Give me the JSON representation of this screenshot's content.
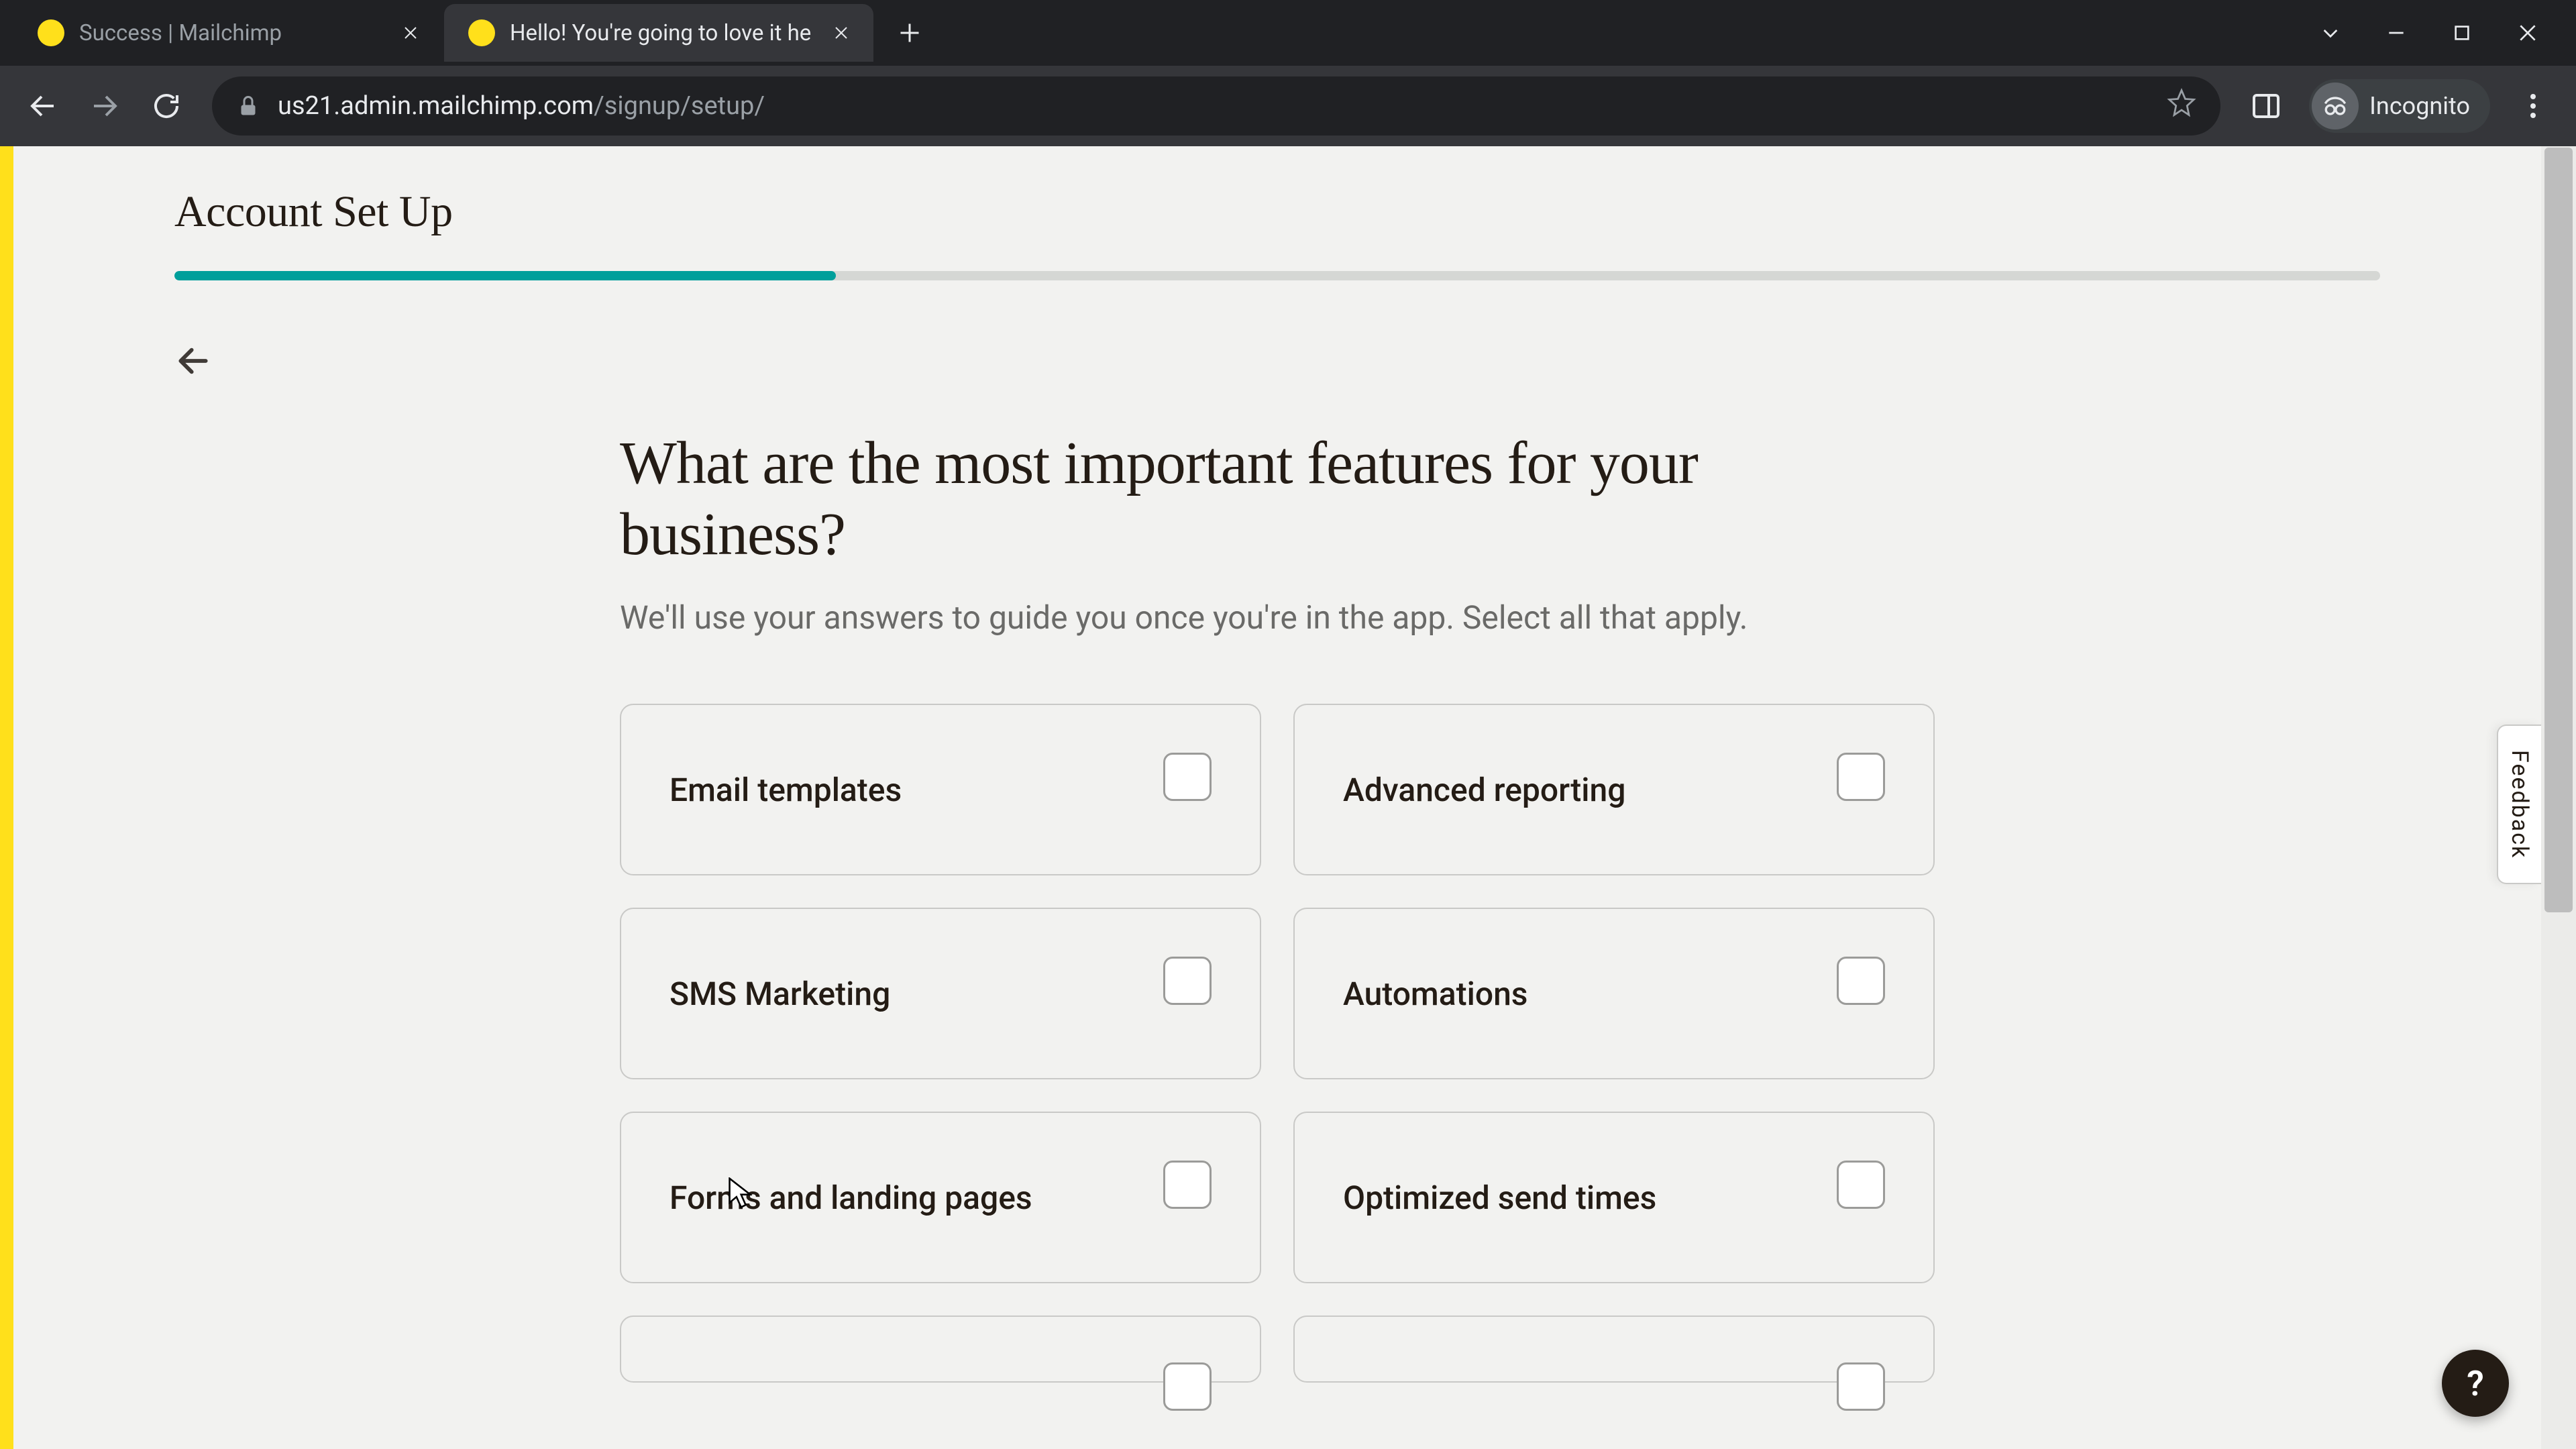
{
  "browser": {
    "tabs": [
      {
        "title": "Success | Mailchimp",
        "active": false
      },
      {
        "title": "Hello! You're going to love it he",
        "active": true
      }
    ],
    "url_domain": "us21.admin.mailchimp.com",
    "url_path": "/signup/setup/",
    "incognito_label": "Incognito"
  },
  "page": {
    "title": "Account Set Up",
    "progress_percent": 30,
    "heading": "What are the most important features for your business?",
    "subtitle": "We'll use your answers to guide you once you're in the app. Select all that apply.",
    "options": [
      "Email templates",
      "Advanced reporting",
      "SMS Marketing",
      "Automations",
      "Forms and landing pages",
      "Optimized send times"
    ],
    "feedback_label": "Feedback",
    "help_label": "?"
  }
}
